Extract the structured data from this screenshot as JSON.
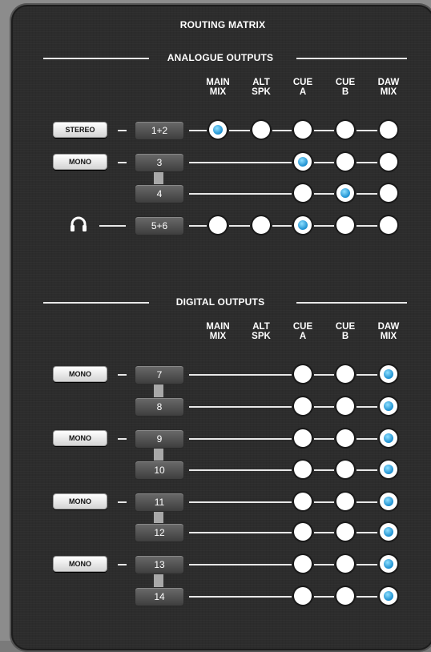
{
  "title": "ROUTING MATRIX",
  "colors": {
    "accent": "#1c8fd0",
    "panel": "#2c2c2c"
  },
  "columns": [
    {
      "line1": "MAIN",
      "line2": "MIX"
    },
    {
      "line1": "ALT",
      "line2": "SPK"
    },
    {
      "line1": "CUE",
      "line2": "A"
    },
    {
      "line1": "CUE",
      "line2": "B"
    },
    {
      "line1": "DAW",
      "line2": "MIX"
    }
  ],
  "sections": [
    {
      "title": "ANALOGUE OUTPUTS",
      "groups": [
        {
          "mode": "STEREO",
          "rows": [
            {
              "label": "1+2",
              "buttons": [
                1,
                1,
                1,
                1,
                1
              ],
              "selected": 0
            }
          ]
        },
        {
          "mode": "MONO",
          "rows": [
            {
              "label": "3",
              "buttons": [
                0,
                0,
                1,
                1,
                1
              ],
              "selected": 2
            },
            {
              "label": "4",
              "buttons": [
                0,
                0,
                1,
                1,
                1
              ],
              "selected": 3
            }
          ]
        },
        {
          "mode": "",
          "icon": "headphones-icon",
          "rows": [
            {
              "label": "5+6",
              "buttons": [
                1,
                1,
                1,
                1,
                1
              ],
              "selected": 2
            }
          ]
        }
      ]
    },
    {
      "title": "DIGITAL OUTPUTS",
      "groups": [
        {
          "mode": "MONO",
          "rows": [
            {
              "label": "7",
              "buttons": [
                0,
                0,
                1,
                1,
                1
              ],
              "selected": 4
            },
            {
              "label": "8",
              "buttons": [
                0,
                0,
                1,
                1,
                1
              ],
              "selected": 4
            }
          ]
        },
        {
          "mode": "MONO",
          "rows": [
            {
              "label": "9",
              "buttons": [
                0,
                0,
                1,
                1,
                1
              ],
              "selected": 4
            },
            {
              "label": "10",
              "buttons": [
                0,
                0,
                1,
                1,
                1
              ],
              "selected": 4
            }
          ]
        },
        {
          "mode": "MONO",
          "rows": [
            {
              "label": "11",
              "buttons": [
                0,
                0,
                1,
                1,
                1
              ],
              "selected": 4
            },
            {
              "label": "12",
              "buttons": [
                0,
                0,
                1,
                1,
                1
              ],
              "selected": 4
            }
          ]
        },
        {
          "mode": "MONO",
          "rows": [
            {
              "label": "13",
              "buttons": [
                0,
                0,
                1,
                1,
                1
              ],
              "selected": 4
            },
            {
              "label": "14",
              "buttons": [
                0,
                0,
                1,
                1,
                1
              ],
              "selected": 4
            }
          ]
        }
      ]
    }
  ]
}
